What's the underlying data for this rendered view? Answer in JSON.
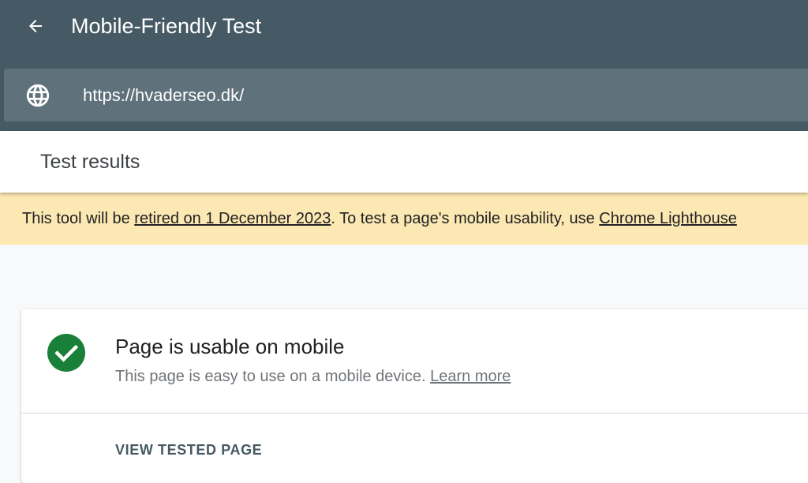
{
  "header": {
    "title": "Mobile-Friendly Test",
    "back_icon": "arrow-left-icon",
    "url_icon": "globe-icon",
    "url_value": "https://hvaderseo.dk/"
  },
  "results": {
    "title": "Test results"
  },
  "notice": {
    "text_before": "This tool will be ",
    "link_retired": "retired on 1 December 2023",
    "text_middle": ". To test a page's mobile usability, use ",
    "link_lighthouse": "Chrome Lighthouse"
  },
  "result_card": {
    "status_icon": "check-circle-icon",
    "title": "Page is usable on mobile",
    "subtitle": "This page is easy to use on a mobile device. ",
    "learn_more": "Learn more",
    "view_button": "VIEW TESTED PAGE"
  },
  "colors": {
    "header_bg": "#455a64",
    "url_bar_bg": "#5f717b",
    "notice_bg": "#fce8b2",
    "success_green": "#188038"
  }
}
